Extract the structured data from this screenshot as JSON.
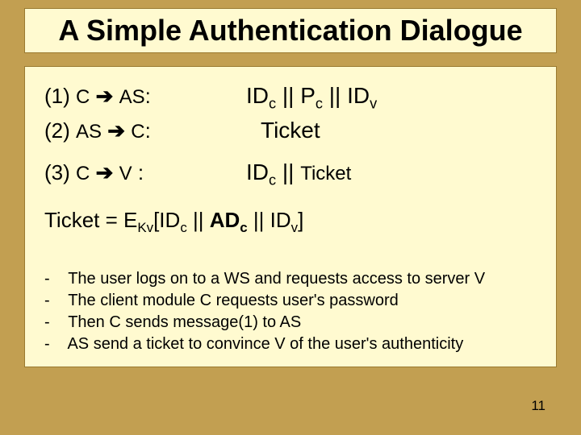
{
  "title": "A Simple Authentication Dialogue",
  "proto": {
    "steps": [
      {
        "num": "(1)",
        "from": "C",
        "to": "AS",
        "sep": ":",
        "msg_html": "ID<span class='sub'>c</span> || P<span class='sub'>c</span> || ID<span class='sub'>v</span>",
        "indent": false
      },
      {
        "num": "(2)",
        "from": "AS",
        "to": "C",
        "sep": ":",
        "msg_html": "Ticket",
        "indent": true
      },
      {
        "num": "(3)",
        "from": "C",
        "to": "V",
        "sep": " :",
        "msg_html": "ID<span class='sub'>c</span> || <span style='font-size:24px;'>Ticket</span>",
        "indent": false
      }
    ],
    "ticket_def_html": "Ticket = E<span class='sub'>Kv</span>[ID<span class='sub'>c</span> || <span class='bold'>AD<span class='sub'>c</span></span> || ID<span class='sub'>v</span>]"
  },
  "explain": [
    "The user logs on to a WS and requests access to server V",
    "The client module C requests user's password",
    " Then C sends message(1) to AS",
    " AS send a ticket to convince V of the user's authenticity"
  ],
  "page_number": "11",
  "arrow_glyph": "➔"
}
